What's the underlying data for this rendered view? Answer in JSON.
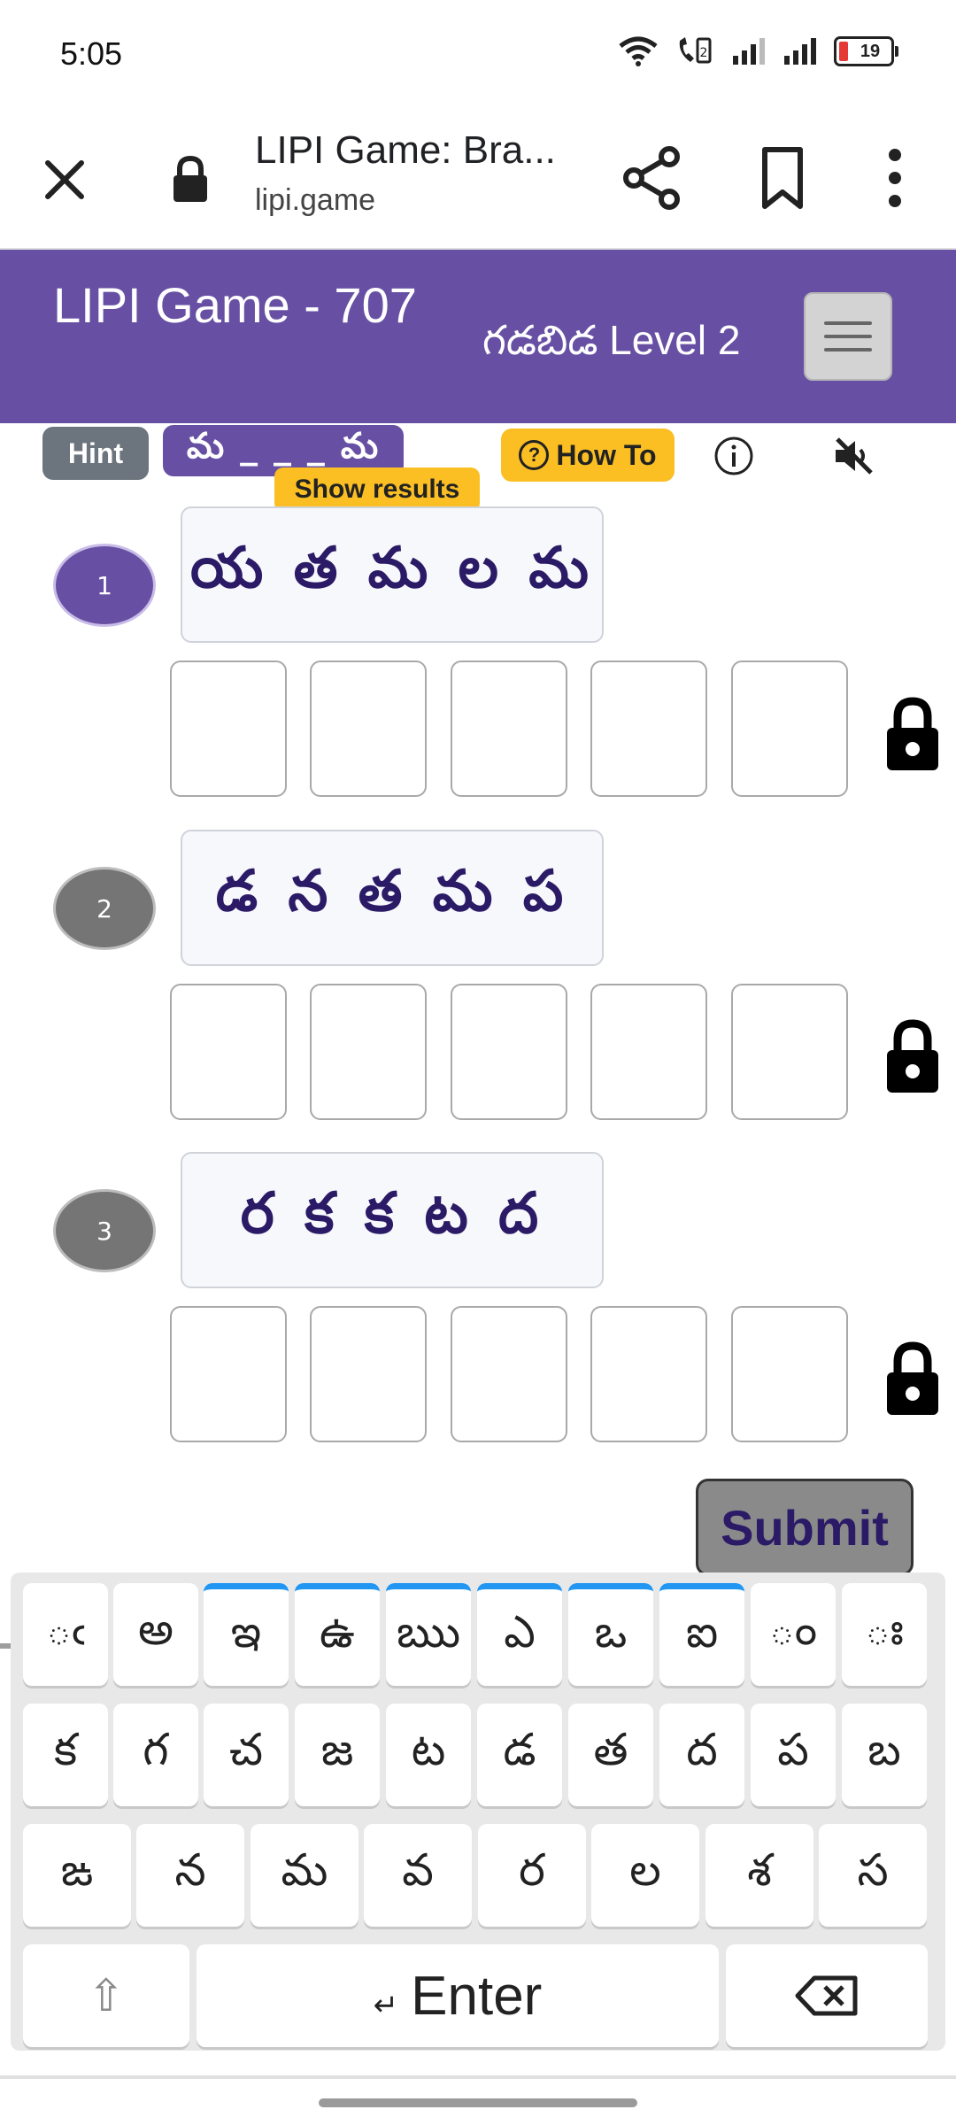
{
  "status_bar": {
    "time": "5:05",
    "battery_level": "19",
    "icons": [
      "wifi-icon",
      "volte-call-icon",
      "signal-icon",
      "signal-icon",
      "battery-icon"
    ]
  },
  "browser": {
    "title": "LIPI Game: Bra...",
    "domain": "lipi.game",
    "icons": [
      "close-icon",
      "lock-icon",
      "share-icon",
      "bookmark-icon",
      "more-vert-icon"
    ]
  },
  "header": {
    "title": "LIPI Game - 707",
    "subtitle": "గడబిడ Level 2",
    "color": "#6750a4"
  },
  "controls": {
    "hint_label": "Hint",
    "hint_pattern": "మ _ _ _ మ",
    "how_to_label": "How To",
    "how_to_icon": "?",
    "show_results_label": "Show results",
    "info_icon": "info-icon",
    "mute_icon": "volume-off-icon"
  },
  "puzzles": [
    {
      "number": "1",
      "scrambled": "య త మ ల మ",
      "active": true
    },
    {
      "number": "2",
      "scrambled": "డ న త మ ప",
      "active": false
    },
    {
      "number": "3",
      "scrambled": "ర క క ట ద",
      "active": false
    }
  ],
  "submit_label": "Submit",
  "keyboard": {
    "row1": [
      "ఁ",
      "అ",
      "ఇ",
      "ఉ",
      "ఋ",
      "ఎ",
      "ఒ",
      "ఐ",
      "ం",
      "ః"
    ],
    "row2": [
      "క",
      "గ",
      "చ",
      "జ",
      "ట",
      "డ",
      "త",
      "ద",
      "ప",
      "బ"
    ],
    "row3": [
      "ఙ",
      "న",
      "మ",
      "వ",
      "ర",
      "ల",
      "శ",
      "స"
    ],
    "shift": "⇧",
    "enter_symbol": "↵",
    "enter_label": "Enter",
    "backspace": "⌫"
  }
}
